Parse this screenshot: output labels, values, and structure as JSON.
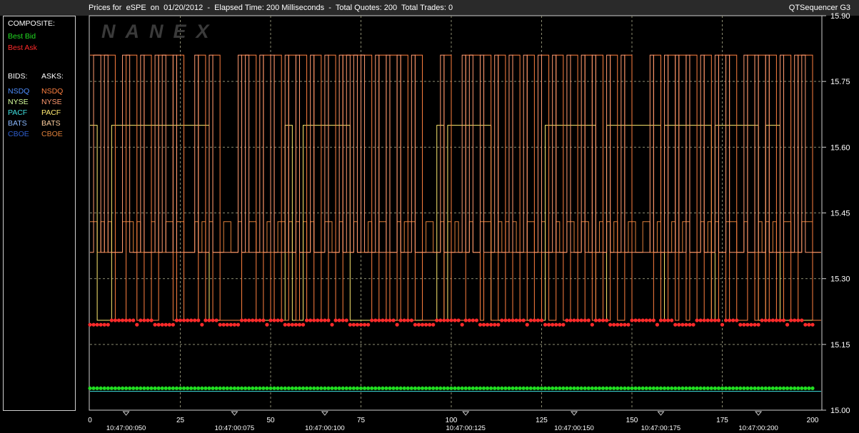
{
  "header": {
    "title": "Prices for  eSPE  on  01/20/2012  -  Elapsed Time: 200 Milliseconds  -  Total Quotes: 200  Total Trades: 0",
    "app": "QTSequencer G3"
  },
  "watermark": "NANEX",
  "legend": {
    "composite_label": "COMPOSITE:",
    "best_bid": {
      "label": "Best Bid",
      "color": "#22dd22"
    },
    "best_ask": {
      "label": "Best Ask",
      "color": "#ff2a2a"
    },
    "bids_label": "BIDS:",
    "asks_label": "ASKS:",
    "bids": [
      {
        "label": "NSDQ",
        "color": "#4f8fff"
      },
      {
        "label": "NYSE",
        "color": "#d8ff9c"
      },
      {
        "label": "PACF",
        "color": "#3fe0e0"
      },
      {
        "label": "BATS",
        "color": "#8ab8ff"
      },
      {
        "label": "CBOE",
        "color": "#2f5fcf"
      }
    ],
    "asks": [
      {
        "label": "NSDQ",
        "color": "#ff8040"
      },
      {
        "label": "NYSE",
        "color": "#ff9a70"
      },
      {
        "label": "PACF",
        "color": "#ffea70"
      },
      {
        "label": "BATS",
        "color": "#ffd0a0"
      },
      {
        "label": "CBOE",
        "color": "#e0803a"
      }
    ]
  },
  "chart_data": {
    "type": "line",
    "x_ticks": [
      0,
      25,
      50,
      75,
      100,
      125,
      150,
      175,
      200
    ],
    "x_range": [
      0,
      200
    ],
    "time_labels": [
      {
        "x": 10,
        "label": "10:47:00:050"
      },
      {
        "x": 40,
        "label": "10:47:00:075"
      },
      {
        "x": 65,
        "label": "10:47:00:100"
      },
      {
        "x": 104,
        "label": "10:47:00:125"
      },
      {
        "x": 134,
        "label": "10:47:00:150"
      },
      {
        "x": 158,
        "label": "10:47:00:175"
      },
      {
        "x": 185,
        "label": "10:47:00:200"
      }
    ],
    "y_ticks": [
      "15.00",
      "15.15",
      "15.30",
      "15.45",
      "15.60",
      "15.75",
      "15.90"
    ],
    "y_range": [
      15.0,
      15.9
    ],
    "grid": true,
    "levels": {
      "ask_high": 15.81,
      "pacf_ask": 15.65,
      "ask_mid_high": 15.43,
      "ask_mid_low": 15.36,
      "best_ask_high": 15.205,
      "best_ask_low": 15.195,
      "best_bid": 15.05,
      "bid_cyan": 15.043
    },
    "series": [
      {
        "name": "Best Bid",
        "color": "#22dd22",
        "values": "constant 15.05 across 0–200"
      },
      {
        "name": "Best Ask",
        "color": "#ff2a2a",
        "values": "alternates 15.195 / 15.205 across 0–200"
      }
    ]
  }
}
